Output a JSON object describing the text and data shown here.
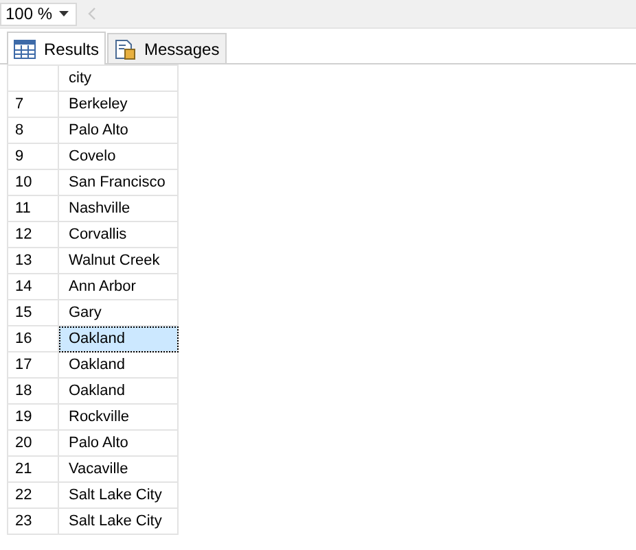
{
  "zoom": {
    "value": "100 %"
  },
  "tabs": [
    {
      "label": "Results",
      "kind": "grid",
      "selected": true
    },
    {
      "label": "Messages",
      "kind": "messages",
      "selected": false
    }
  ],
  "table": {
    "columns": [
      "city"
    ],
    "rows": [
      {
        "number": "7",
        "city": "Berkeley",
        "selected": false
      },
      {
        "number": "8",
        "city": "Palo Alto",
        "selected": false
      },
      {
        "number": "9",
        "city": "Covelo",
        "selected": false
      },
      {
        "number": "10",
        "city": "San Francisco",
        "selected": false
      },
      {
        "number": "11",
        "city": "Nashville",
        "selected": false
      },
      {
        "number": "12",
        "city": "Corvallis",
        "selected": false
      },
      {
        "number": "13",
        "city": "Walnut Creek",
        "selected": false
      },
      {
        "number": "14",
        "city": "Ann Arbor",
        "selected": false
      },
      {
        "number": "15",
        "city": "Gary",
        "selected": false
      },
      {
        "number": "16",
        "city": "Oakland",
        "selected": true
      },
      {
        "number": "17",
        "city": "Oakland",
        "selected": false
      },
      {
        "number": "18",
        "city": "Oakland",
        "selected": false
      },
      {
        "number": "19",
        "city": "Rockville",
        "selected": false
      },
      {
        "number": "20",
        "city": "Palo Alto",
        "selected": false
      },
      {
        "number": "21",
        "city": "Vacaville",
        "selected": false
      },
      {
        "number": "22",
        "city": "Salt Lake City",
        "selected": false
      },
      {
        "number": "23",
        "city": "Salt Lake City",
        "selected": false
      }
    ]
  }
}
